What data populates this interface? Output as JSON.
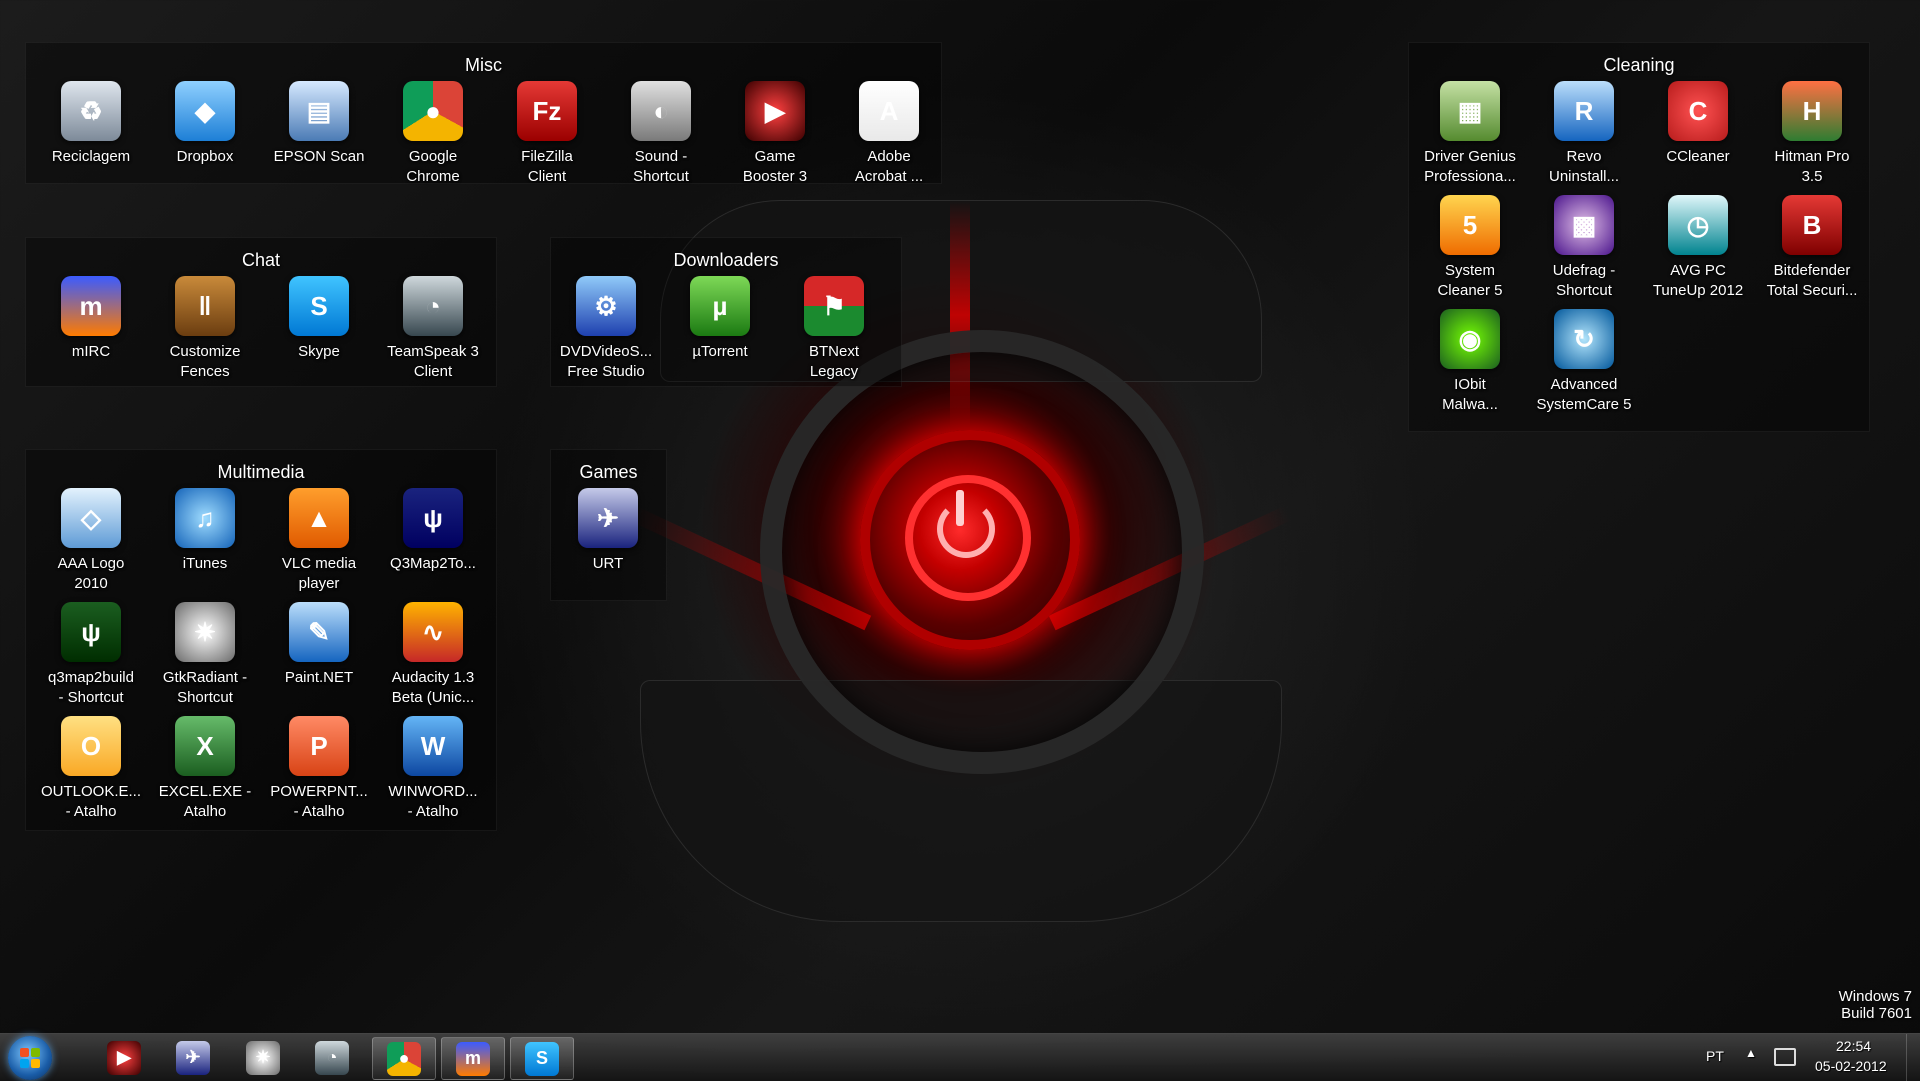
{
  "fences": {
    "misc": {
      "title": "Misc",
      "items": [
        {
          "label": "Reciclagem",
          "icon": "recycle-bin-icon"
        },
        {
          "label": "Dropbox",
          "icon": "dropbox-icon"
        },
        {
          "label": "EPSON Scan",
          "icon": "scanner-icon"
        },
        {
          "label": "Google\nChrome",
          "icon": "chrome-icon"
        },
        {
          "label": "FileZilla\nClient",
          "icon": "filezilla-icon"
        },
        {
          "label": "Sound -\nShortcut",
          "icon": "speaker-icon"
        },
        {
          "label": "Game\nBooster 3",
          "icon": "game-booster-icon"
        },
        {
          "label": "Adobe\nAcrobat ...",
          "icon": "acrobat-icon"
        }
      ]
    },
    "chat": {
      "title": "Chat",
      "items": [
        {
          "label": "mIRC",
          "icon": "mirc-icon"
        },
        {
          "label": "Customize\nFences",
          "icon": "fences-icon"
        },
        {
          "label": "Skype",
          "icon": "skype-icon"
        },
        {
          "label": "TeamSpeak 3\nClient",
          "icon": "teamspeak-icon"
        }
      ]
    },
    "downloaders": {
      "title": "Downloaders",
      "items": [
        {
          "label": "DVDVideoS...\nFree Studio",
          "icon": "dvdvideosoft-icon"
        },
        {
          "label": "µTorrent",
          "icon": "utorrent-icon"
        },
        {
          "label": "BTNext\nLegacy",
          "icon": "btnext-icon"
        }
      ]
    },
    "multimedia": {
      "title": "Multimedia",
      "items": [
        {
          "label": "AAA Logo\n2010",
          "icon": "aaa-logo-icon"
        },
        {
          "label": "iTunes",
          "icon": "itunes-icon"
        },
        {
          "label": "VLC media\nplayer",
          "icon": "vlc-icon"
        },
        {
          "label": "Q3Map2To...",
          "icon": "q3map2-toolz-icon"
        },
        {
          "label": "q3map2build\n- Shortcut",
          "icon": "q3map2build-icon"
        },
        {
          "label": "GtkRadiant -\nShortcut",
          "icon": "gtkradiant-icon"
        },
        {
          "label": "Paint.NET",
          "icon": "paintnet-icon"
        },
        {
          "label": "Audacity 1.3\nBeta (Unic...",
          "icon": "audacity-icon"
        },
        {
          "label": "OUTLOOK.E...\n- Atalho",
          "icon": "outlook-icon"
        },
        {
          "label": "EXCEL.EXE -\nAtalho",
          "icon": "excel-icon"
        },
        {
          "label": "POWERPNT...\n- Atalho",
          "icon": "powerpoint-icon"
        },
        {
          "label": "WINWORD...\n- Atalho",
          "icon": "word-icon"
        }
      ]
    },
    "games": {
      "title": "Games",
      "items": [
        {
          "label": "URT",
          "icon": "urban-terror-icon"
        }
      ]
    },
    "cleaning": {
      "title": "Cleaning",
      "items": [
        {
          "label": "Driver Genius\nProfessiona...",
          "icon": "driver-genius-icon"
        },
        {
          "label": "Revo\nUninstall...",
          "icon": "revo-uninstaller-icon"
        },
        {
          "label": "CCleaner",
          "icon": "ccleaner-icon"
        },
        {
          "label": "Hitman Pro\n3.5",
          "icon": "hitmanpro-icon"
        },
        {
          "label": "System\nCleaner 5",
          "icon": "system-cleaner-icon"
        },
        {
          "label": "Udefrag -\nShortcut",
          "icon": "udefrag-icon"
        },
        {
          "label": "AVG PC\nTuneUp 2012",
          "icon": "avg-tuneup-icon"
        },
        {
          "label": "Bitdefender\nTotal Securi...",
          "icon": "bitdefender-icon"
        },
        {
          "label": "IObit\nMalwa...",
          "icon": "iobit-malware-icon"
        },
        {
          "label": "Advanced\nSystemCare 5",
          "icon": "advanced-systemcare-icon"
        }
      ]
    }
  },
  "watermark": {
    "line1": "Windows 7",
    "line2": "Build 7601"
  },
  "taskbar": {
    "start_icon": "windows-start-orb-icon",
    "pinned": [
      {
        "name": "game-booster",
        "icon": "game-booster-icon",
        "active": false
      },
      {
        "name": "urban-terror",
        "icon": "urban-terror-icon",
        "active": false
      },
      {
        "name": "gtkradiant",
        "icon": "gtkradiant-icon",
        "active": false
      },
      {
        "name": "teamspeak",
        "icon": "teamspeak-icon",
        "active": false
      },
      {
        "name": "chrome",
        "icon": "chrome-icon",
        "active": true
      },
      {
        "name": "mirc",
        "icon": "mirc-icon",
        "active": true
      },
      {
        "name": "skype",
        "icon": "skype-icon",
        "active": true
      }
    ],
    "tray": {
      "language": "PT",
      "show_hidden_icon": "up-arrow-icon",
      "network_icon": "network-icon",
      "time": "22:54",
      "date": "05-02-2012"
    }
  },
  "colors": {
    "accent_red": "#e00000",
    "taskbar": "#2a2a2a",
    "fence_bg": "#000000"
  }
}
